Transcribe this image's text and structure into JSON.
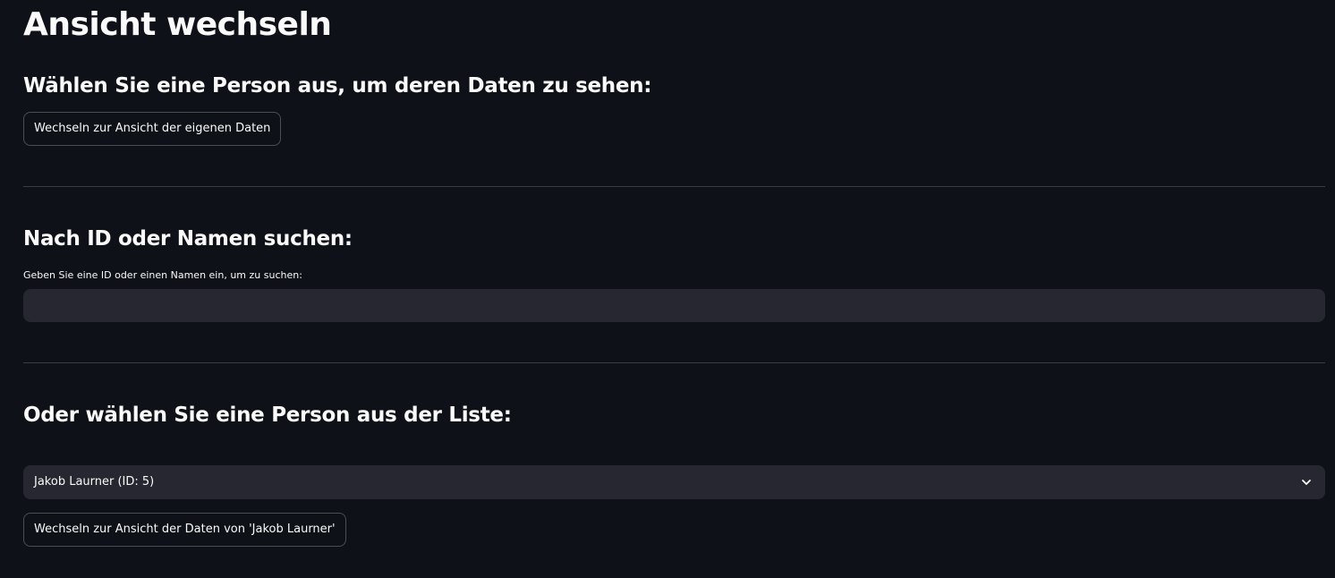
{
  "page": {
    "title": "Ansicht wechseln"
  },
  "section_own": {
    "heading": "Wählen Sie eine Person aus, um deren Daten zu sehen:",
    "own_button_label": "Wechseln zur Ansicht der eigenen Daten"
  },
  "section_search": {
    "heading": "Nach ID oder Namen suchen:",
    "input_label": "Geben Sie eine ID oder einen Namen ein, um zu suchen:",
    "input_value": "",
    "input_placeholder": ""
  },
  "section_list": {
    "heading": "Oder wählen Sie eine Person aus der Liste:",
    "selected_option": "Jakob Laurner (ID: 5)",
    "switch_button_label": "Wechseln zur Ansicht der Daten von 'Jakob Laurner'"
  },
  "icons": {
    "dropdown": "chevron-down-icon"
  },
  "colors": {
    "background": "#0e1117",
    "input_background": "#262730",
    "text": "#fafafa",
    "border": "#4b4e57"
  }
}
